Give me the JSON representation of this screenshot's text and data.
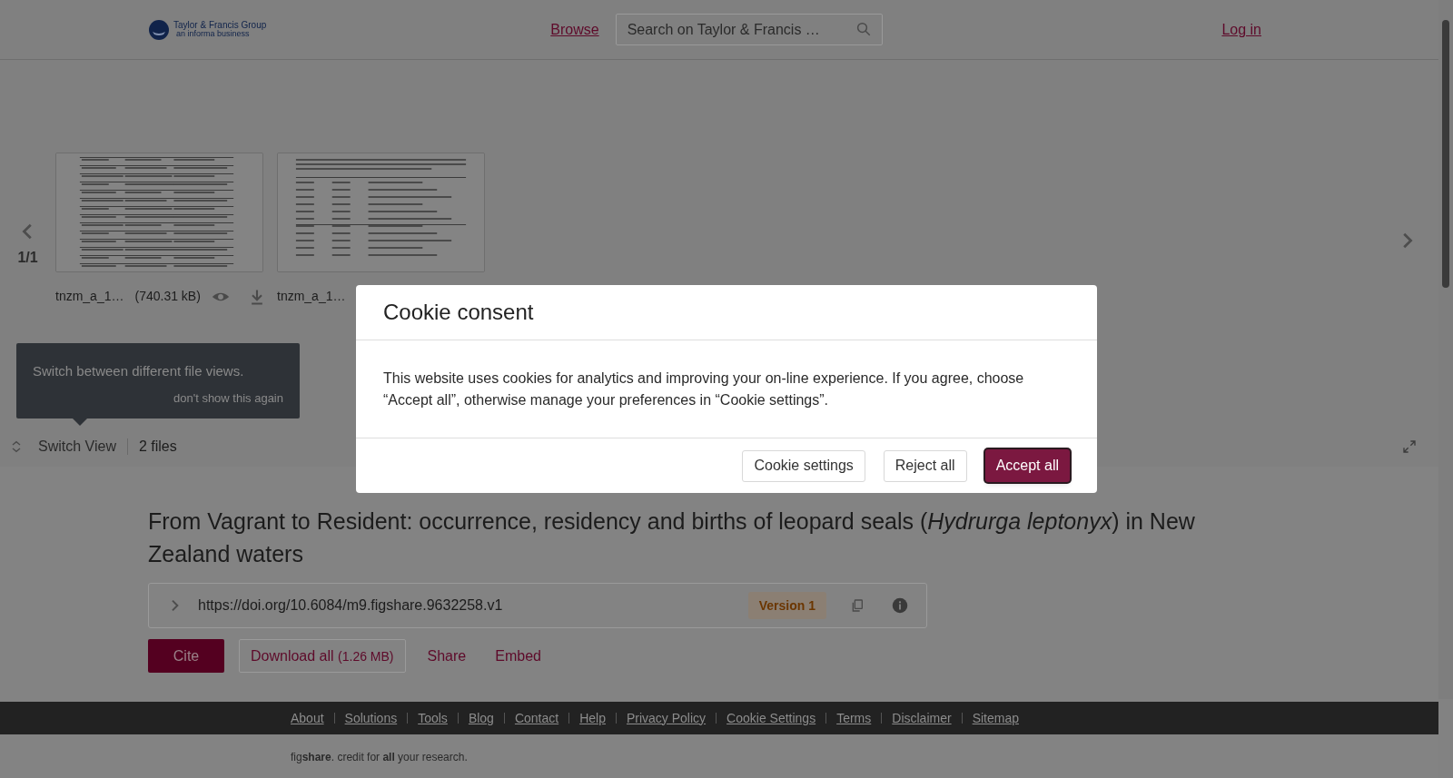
{
  "header": {
    "logo": {
      "name": "Taylor & Francis Group",
      "tagline": "an informa business"
    },
    "nav_link": "Browse",
    "search": {
      "placeholder": "Search on Taylor & Francis …"
    },
    "login": "Log in"
  },
  "viewer": {
    "pager": "1/1",
    "files": [
      {
        "name": "tnzm_a_1…",
        "size": "(740.31 kB)"
      },
      {
        "name": "tnzm_a_1…"
      }
    ],
    "tooltip": {
      "text": "Switch between different file views.",
      "dismiss": "don't show this again"
    },
    "switch_view": "Switch View",
    "file_count": "2 files"
  },
  "item": {
    "title": "From Vagrant to Resident: occurrence, residency and births of leopard seals (*Hydrurga leptonyx*) in New Zealand waters",
    "doi": "https://doi.org/10.6084/m9.figshare.9632258.v1",
    "version": "Version 1",
    "actions": [
      {
        "kind": "primary",
        "label": "Cite"
      },
      {
        "kind": "outline",
        "label": "Download all",
        "size": "(1.26 MB)"
      },
      {
        "kind": "link",
        "label": "Share"
      },
      {
        "kind": "link",
        "label": "Embed"
      }
    ]
  },
  "footer": {
    "links": [
      "About",
      "Solutions",
      "Tools",
      "Blog",
      "Contact",
      "Help",
      "Privacy Policy",
      "Cookie Settings",
      "Terms",
      "Disclaimer",
      "Sitemap"
    ],
    "tagline": "fig**share**. credit for **all** your research."
  },
  "cookie_dialog": {
    "title": "Cookie consent",
    "body": "This website uses cookies for analytics and improving your on-line experience. If you agree, choose “Accept all”, otherwise manage your preferences in “Cookie settings”.",
    "buttons": [
      {
        "kind": "secondary",
        "label": "Cookie settings"
      },
      {
        "kind": "secondary",
        "label": "Reject all"
      },
      {
        "kind": "primary",
        "label": "Accept all"
      }
    ]
  }
}
